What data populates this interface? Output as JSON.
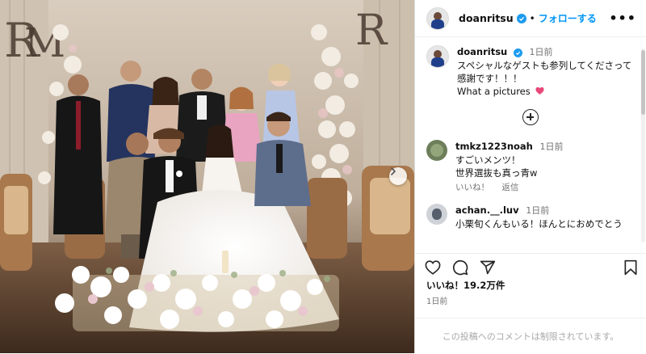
{
  "post": {
    "username": "doanritsu",
    "follow_label": "フォローする",
    "separator": "•",
    "more_icon": "more-horizontal-icon"
  },
  "caption": {
    "username": "doanritsu",
    "time": "1日前",
    "lines": [
      "スペシャルなゲストも参列してくださって",
      "感謝です！！！",
      "What a pictures"
    ],
    "emoji": "heart-emoji-pink"
  },
  "comments": [
    {
      "username": "tmkz1223noah",
      "time": "1日前",
      "lines": [
        "すごいメンツ！",
        "世界選抜も真っ青w"
      ],
      "like_label": "いいね！",
      "reply_label": "返信"
    },
    {
      "username": "achan.__.luv",
      "time": "1日前",
      "lines": [
        "小栗旬くんもいる！ほんとにおめでとう"
      ]
    }
  ],
  "actions": {
    "icons": [
      "heart-icon",
      "comment-icon",
      "share-icon",
      "bookmark-icon"
    ]
  },
  "likes_text": "いいね！19.2万件",
  "date_text": "1日前",
  "comments_closed_text": "この投稿へのコメントは制限されています。",
  "colors": {
    "accent": "#0095f6",
    "verified": "#1d9bf0",
    "heart_emoji": "#e8487a"
  }
}
